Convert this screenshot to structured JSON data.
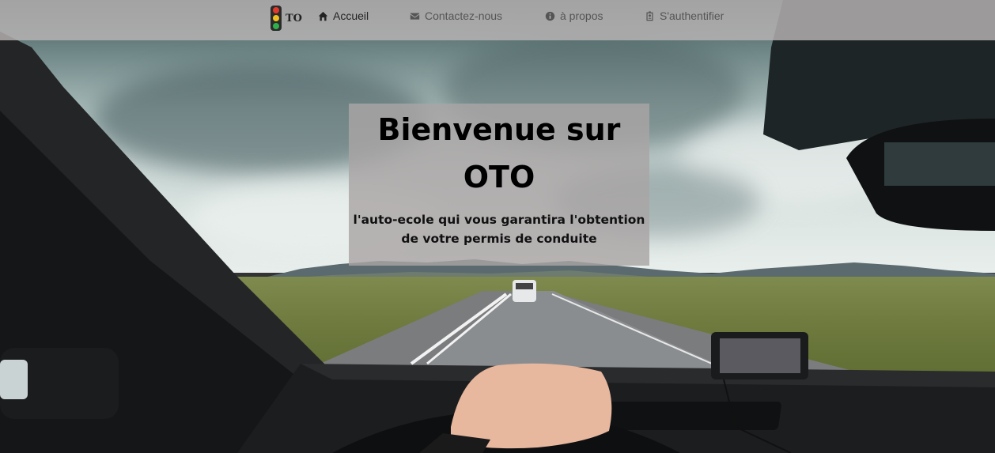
{
  "nav": {
    "brand": "TO",
    "items": [
      {
        "label": "Accueil",
        "icon": "home-icon"
      },
      {
        "label": "Contactez-nous",
        "icon": "envelope-icon"
      },
      {
        "label": "à propos",
        "icon": "info-icon"
      },
      {
        "label": "S'authentifier",
        "icon": "id-badge-icon"
      }
    ]
  },
  "hero": {
    "title": "Bienvenue sur OTO",
    "subtitle": "l'auto-ecole qui vous garantira l'obtention de votre permis de conduite"
  },
  "colors": {
    "navbar_bg": "#b9b4b4",
    "hero_bg": "#aaa5a5"
  }
}
